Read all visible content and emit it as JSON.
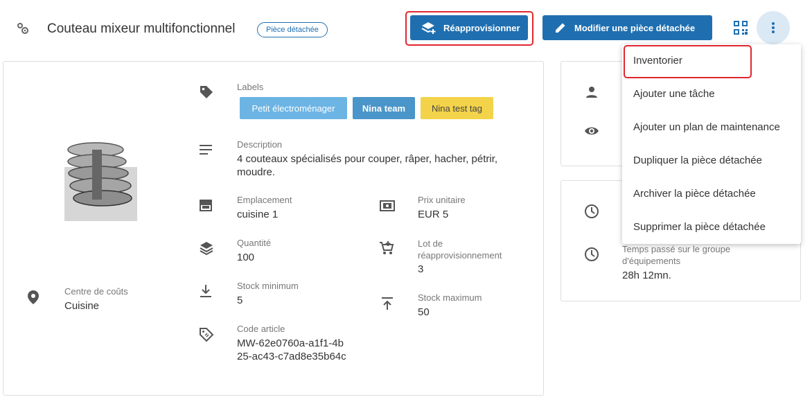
{
  "header": {
    "title": "Couteau mixeur multifonctionnel",
    "badge": "Pièce détachée",
    "restock_button": "Réapprovisionner",
    "edit_button": "Modifier une pièce détachée"
  },
  "labels_section": {
    "label": "Labels",
    "tags": [
      {
        "text": "Petit électroménager",
        "color": "#6cb4e4"
      },
      {
        "text": "Nina team",
        "color": "#4a95c9"
      },
      {
        "text": "Nina test tag",
        "color": "#f3d34a"
      }
    ]
  },
  "description": {
    "label": "Description",
    "value": "4 couteaux spécialisés pour couper, râper, hacher, pétrir, moudre."
  },
  "location": {
    "label": "Emplacement",
    "value": "cuisine 1"
  },
  "unit_price": {
    "label": "Prix unitaire",
    "value": "EUR 5"
  },
  "quantity": {
    "label": "Quantité",
    "value": "100"
  },
  "restock_lot": {
    "label": "Lot de réapprovisionnement",
    "value": "3"
  },
  "min_stock": {
    "label": "Stock minimum",
    "value": "5"
  },
  "max_stock": {
    "label": "Stock maximum",
    "value": "50"
  },
  "article_code": {
    "label": "Code article",
    "value": "MW-62e0760a-a1f1-4b25-ac43-c7ad8e35b64c"
  },
  "cost_center": {
    "label": "Centre de coûts",
    "value": "Cuisine"
  },
  "time_spent": {
    "label": "Temps passé sur le groupe d'équipements",
    "value": "28h 12mn."
  },
  "menu": {
    "items": [
      "Inventorier",
      "Ajouter une tâche",
      "Ajouter un plan de maintenance",
      "Dupliquer la pièce détachée",
      "Archiver la pièce détachée",
      "Supprimer la pièce détachée"
    ]
  },
  "colors": {
    "primary": "#1f6fb0",
    "highlight": "#e0262d"
  }
}
